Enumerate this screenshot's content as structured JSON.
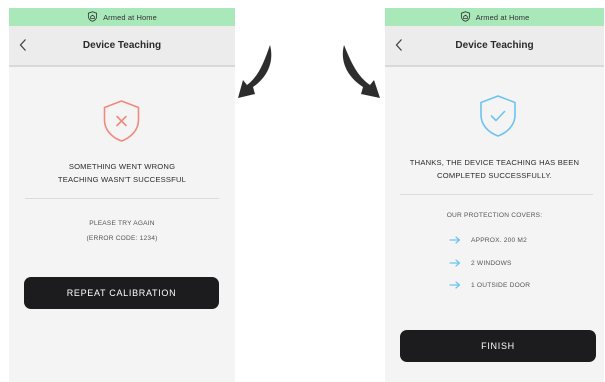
{
  "colors": {
    "status_green": "#a8e8b9",
    "error_red": "#f08a7e",
    "success_blue": "#6ec3ef",
    "button_dark": "#1c1c1e"
  },
  "left_screen": {
    "status_text": "Armed at Home",
    "status_icon": "home-shield-icon",
    "back_icon": "chevron-left-icon",
    "title": "Device Teaching",
    "state_icon": "shield-x-icon",
    "message_line1": "SOMETHING WENT WRONG",
    "message_line2": "TEACHING WASN'T SUCCESSFUL",
    "retry_text": "PLEASE TRY AGAIN",
    "error_code": "(ERROR CODE: 1234)",
    "button_label": "REPEAT CALIBRATION"
  },
  "right_screen": {
    "status_text": "Armed at Home",
    "status_icon": "home-shield-icon",
    "back_icon": "chevron-left-icon",
    "title": "Device Teaching",
    "state_icon": "shield-check-icon",
    "message_line1": "THANKS, THE DEVICE TEACHING HAS BEEN",
    "message_line2": "COMPLETED SUCCESSFULLY.",
    "coverage_title": "OUR PROTECTION COVERS:",
    "coverage_items": [
      "APPROX.  200 M2",
      "2 WINDOWS",
      "1 OUTSIDE DOOR"
    ],
    "button_label": "FINISH"
  },
  "decorations": {
    "left_arrow_icon": "curved-arrow-down-left-icon",
    "right_arrow_icon": "curved-arrow-down-right-icon"
  }
}
